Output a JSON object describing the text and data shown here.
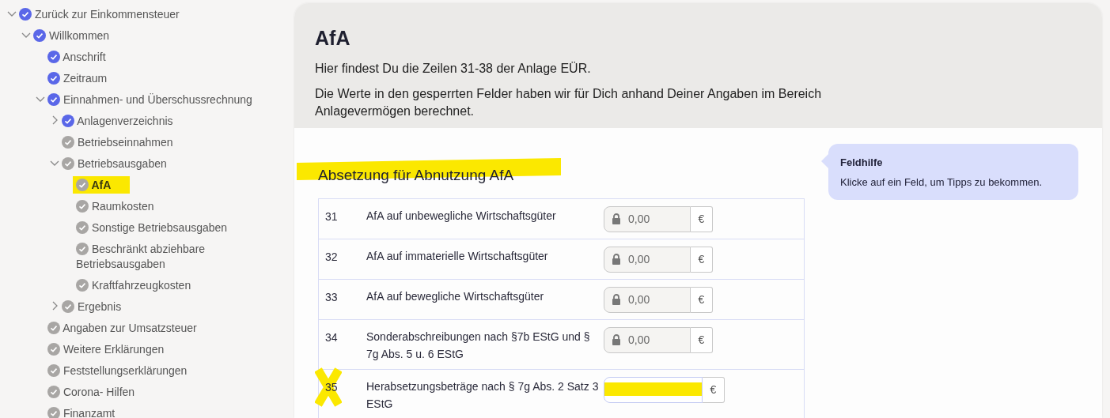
{
  "sidebar": {
    "items": [
      {
        "label": "Zurück zur Einkommensteuer",
        "done": true,
        "expanded": true,
        "selected": false,
        "highlighted": false,
        "children": [
          {
            "label": "Willkommen",
            "done": true,
            "expanded": true,
            "selected": false,
            "highlighted": false,
            "children": [
              {
                "label": "Anschrift",
                "done": true,
                "selected": false,
                "highlighted": false
              },
              {
                "label": "Zeitraum",
                "done": true,
                "selected": false,
                "highlighted": false
              },
              {
                "label": "Einnahmen- und Überschussrechnung",
                "done": true,
                "expanded": true,
                "selected": false,
                "highlighted": false,
                "children": [
                  {
                    "label": "Anlagenverzeichnis",
                    "done": true,
                    "expanded": false,
                    "selected": false,
                    "highlighted": false
                  },
                  {
                    "label": "Betriebseinnahmen",
                    "done": false,
                    "selected": false,
                    "highlighted": false
                  },
                  {
                    "label": "Betriebsausgaben",
                    "done": false,
                    "expanded": true,
                    "selected": false,
                    "highlighted": false,
                    "children": [
                      {
                        "label": "AfA",
                        "done": false,
                        "selected": true,
                        "highlighted": true
                      },
                      {
                        "label": "Raumkosten",
                        "done": false,
                        "selected": false,
                        "highlighted": false
                      },
                      {
                        "label": "Sonstige Betriebsausgaben",
                        "done": false,
                        "selected": false,
                        "highlighted": false
                      },
                      {
                        "label": "Beschränkt abziehbare Betriebsausgaben",
                        "done": false,
                        "selected": false,
                        "highlighted": false
                      },
                      {
                        "label": "Kraftfahrzeugkosten",
                        "done": false,
                        "selected": false,
                        "highlighted": false
                      }
                    ]
                  },
                  {
                    "label": "Ergebnis",
                    "done": false,
                    "expanded": false,
                    "selected": false,
                    "highlighted": false
                  }
                ]
              },
              {
                "label": "Angaben zur Umsatzsteuer",
                "done": false,
                "selected": false,
                "highlighted": false
              },
              {
                "label": "Weitere Erklärungen",
                "done": false,
                "selected": false,
                "highlighted": false
              },
              {
                "label": "Feststellungserklärungen",
                "done": false,
                "selected": false,
                "highlighted": false
              },
              {
                "label": "Corona- Hilfen",
                "done": false,
                "selected": false,
                "highlighted": false
              },
              {
                "label": "Finanzamt",
                "done": false,
                "selected": false,
                "highlighted": false
              }
            ]
          }
        ]
      }
    ]
  },
  "header": {
    "title": "AfA",
    "paragraphs": [
      "Hier findest Du die Zeilen 31-38 der Anlage EÜR.",
      "Die Werte in den gesperrten Felder haben wir für Dich anhand Deiner Angaben im Bereich Anlagevermögen berechnet."
    ]
  },
  "section": {
    "heading": "Absetzung für Abnutzung AfA",
    "highlighted": true,
    "rows": [
      {
        "number": "31",
        "label": "AfA auf unbewegliche Wirtschaftsgüter",
        "marked": false,
        "field": {
          "locked": true,
          "value": "0,00",
          "unit": "€",
          "highlighted": false
        }
      },
      {
        "number": "32",
        "label": "AfA auf immaterielle Wirtschaftsgüter",
        "marked": false,
        "field": {
          "locked": true,
          "value": "0,00",
          "unit": "€",
          "highlighted": false
        }
      },
      {
        "number": "33",
        "label": "AfA auf bewegliche Wirtschaftsgüter",
        "marked": false,
        "field": {
          "locked": true,
          "value": "0,00",
          "unit": "€",
          "highlighted": false
        }
      },
      {
        "number": "34",
        "label": "Sonderabschreibungen nach §7b EStG und § 7g Abs. 5 u. 6 EStG",
        "marked": false,
        "field": {
          "locked": true,
          "value": "0,00",
          "unit": "€",
          "highlighted": false
        }
      },
      {
        "number": "35",
        "label": "Herabsetzungsbeträge nach § 7g Abs. 2 Satz 3 EStG",
        "marked": true,
        "field": {
          "locked": false,
          "unit": "€",
          "highlighted": true
        }
      }
    ]
  },
  "help": {
    "title": "Feldhilfe",
    "text": "Klicke auf ein Feld, um Tipps zu bekommen."
  }
}
